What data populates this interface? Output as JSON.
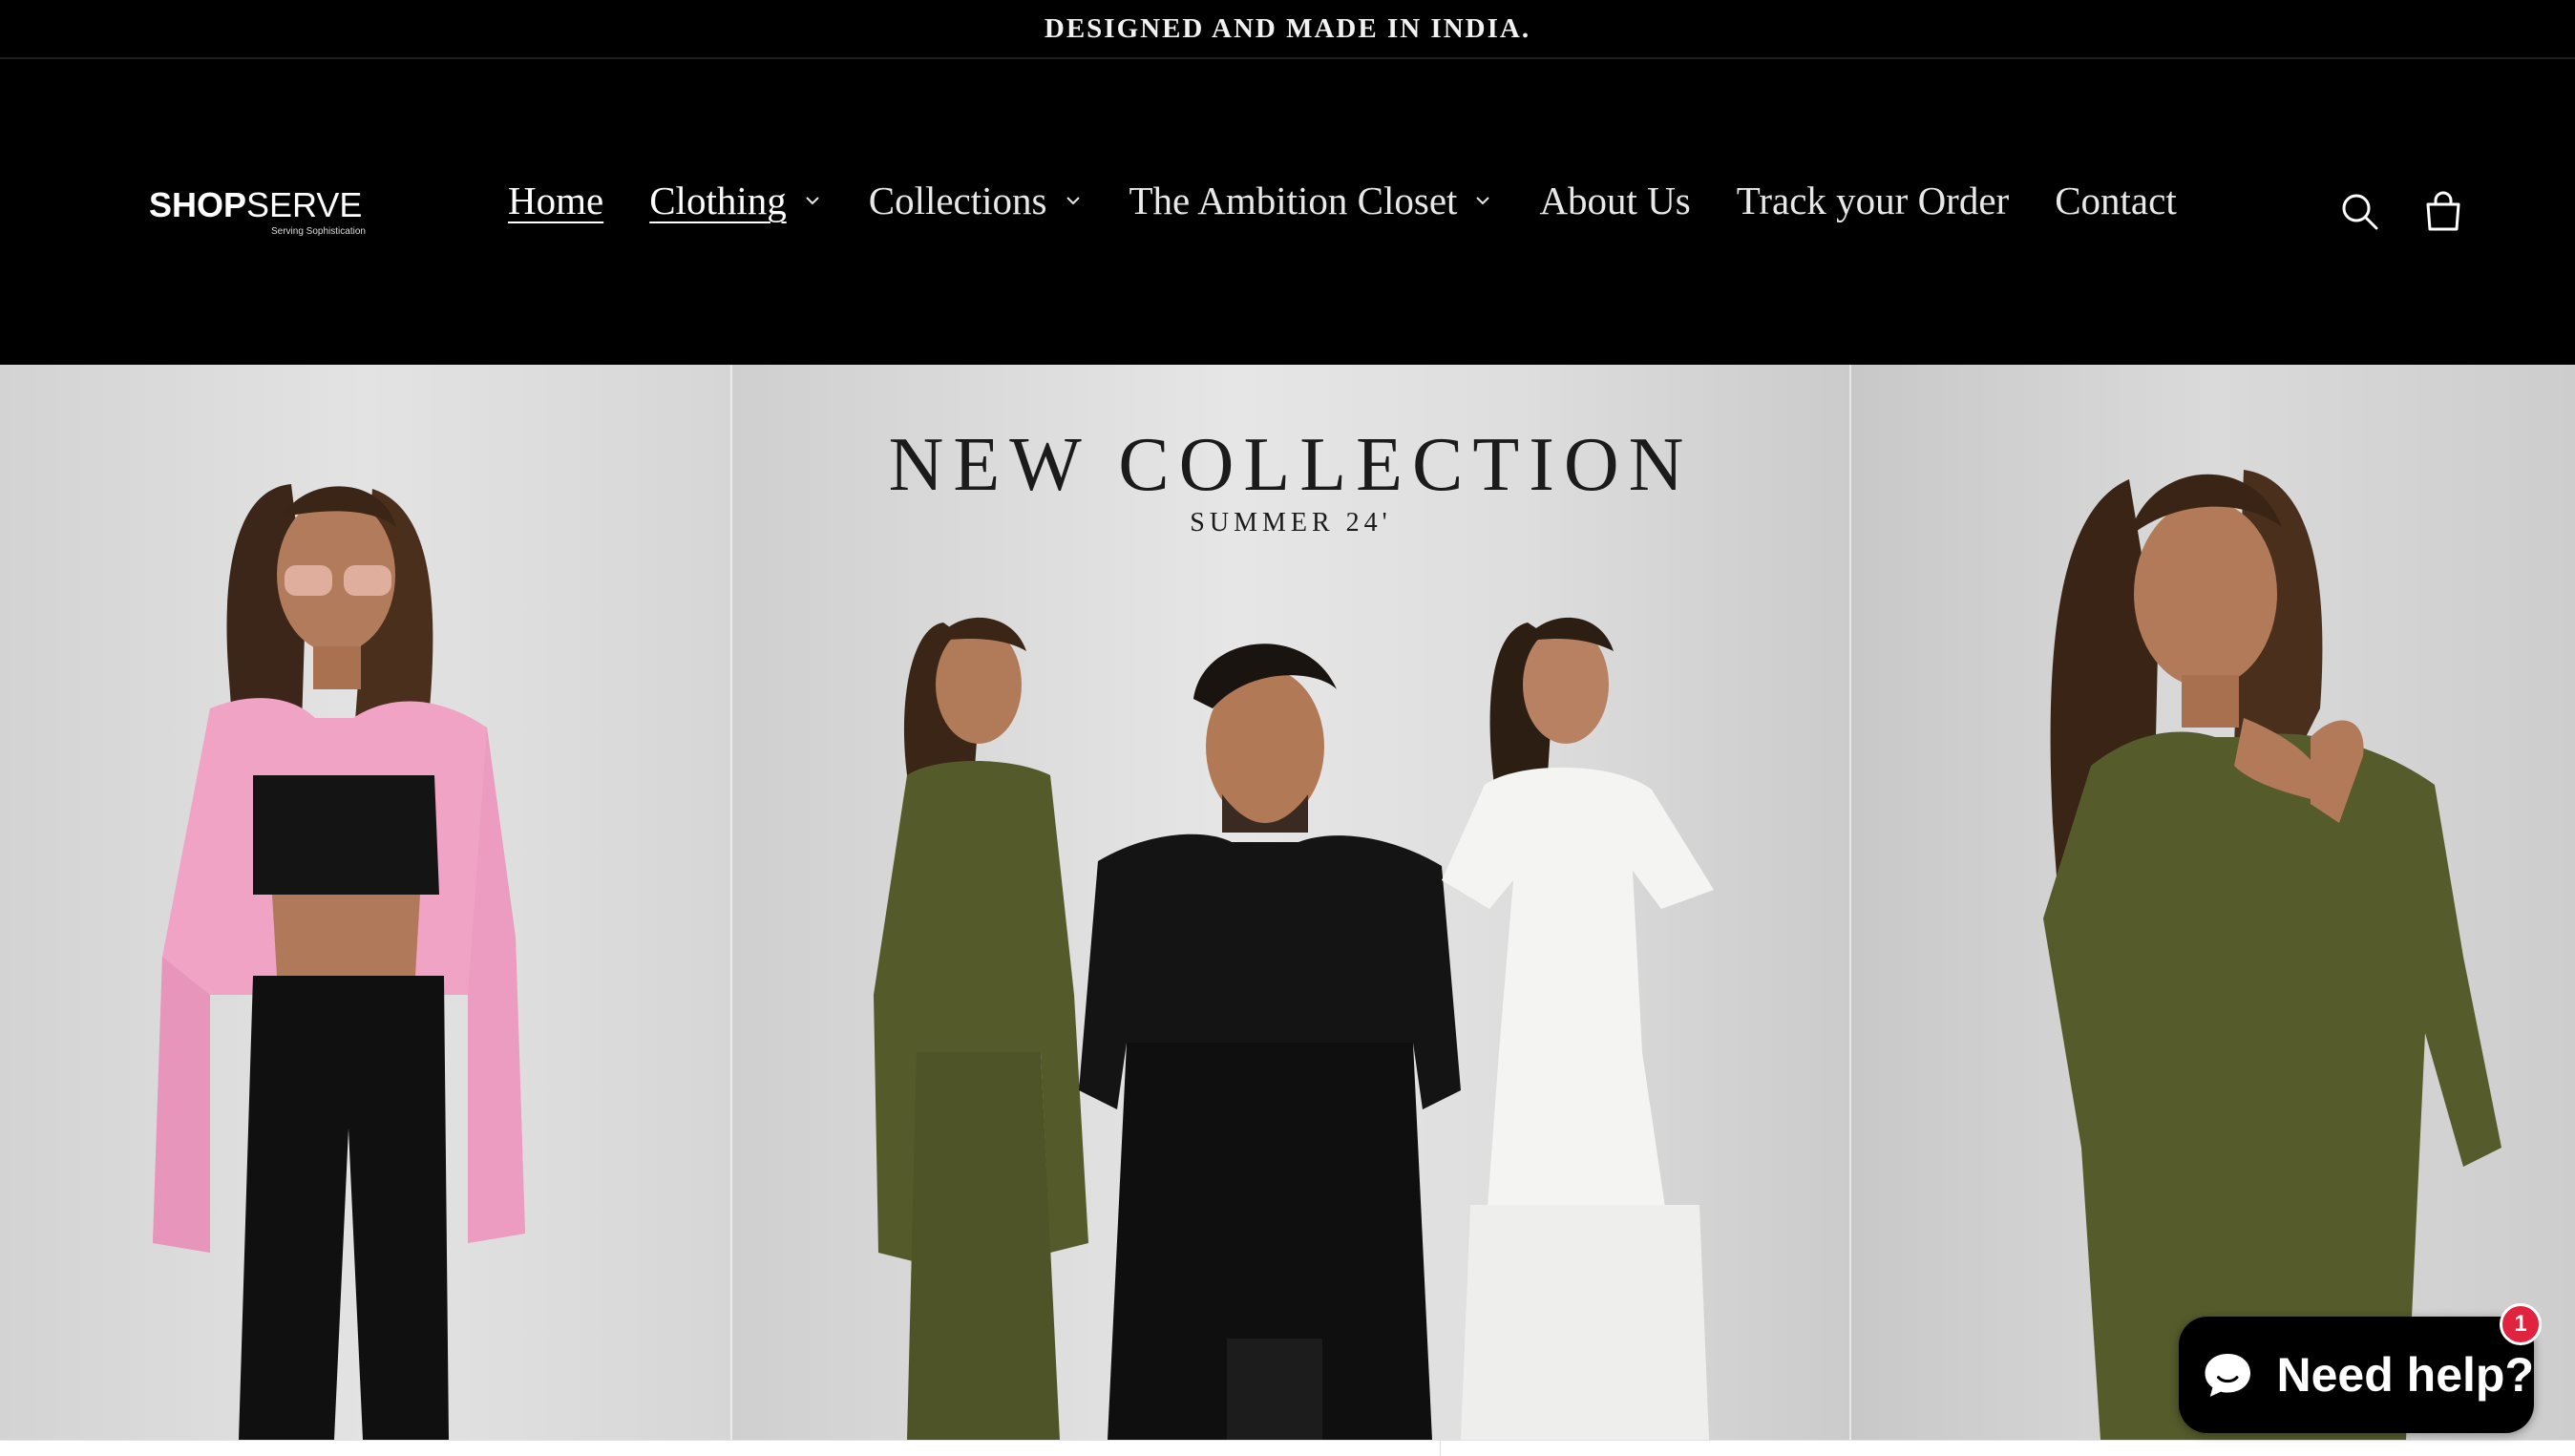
{
  "announcement": {
    "text": "DESIGNED AND MADE IN INDIA."
  },
  "header": {
    "logo": {
      "primary": "SHOP",
      "secondary": "SERVE",
      "tagline": "Serving Sophistication"
    },
    "nav": [
      {
        "label": "Home",
        "active": true,
        "dropdown": false
      },
      {
        "label": "Clothing",
        "active": false,
        "dropdown": true
      },
      {
        "label": "Collections",
        "active": false,
        "dropdown": true
      },
      {
        "label": "The Ambition Closet",
        "active": false,
        "dropdown": true
      },
      {
        "label": "About Us",
        "active": false,
        "dropdown": false
      },
      {
        "label": "Track your Order",
        "active": false,
        "dropdown": false
      },
      {
        "label": "Contact",
        "active": false,
        "dropdown": false
      }
    ],
    "icons": [
      "search-icon",
      "cart-icon"
    ]
  },
  "hero": {
    "title": "NEW COLLECTION",
    "subtitle": "SUMMER 24'"
  },
  "chat_widget": {
    "label": "Need help?",
    "badge_count": "1",
    "icon": "chat-bubble-icon"
  },
  "colors": {
    "header_bg": "#000000",
    "text_light": "#ffffff",
    "badge": "#e0243f",
    "pink_shirt": "#f2a6c8",
    "olive": "#545a2a",
    "black_outfit": "#141414",
    "white_dress": "#f4f4f2"
  }
}
